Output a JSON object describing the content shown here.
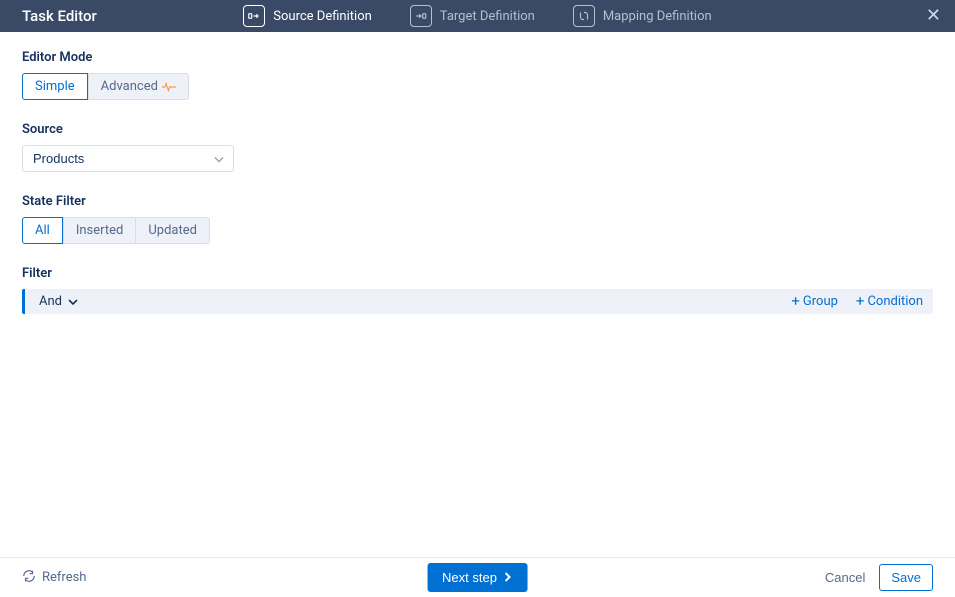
{
  "header": {
    "title": "Task Editor",
    "steps": [
      {
        "label": "Source Definition",
        "active": true
      },
      {
        "label": "Target Definition",
        "active": false
      },
      {
        "label": "Mapping Definition",
        "active": false
      }
    ]
  },
  "editor_mode": {
    "label": "Editor Mode",
    "options": [
      "Simple",
      "Advanced"
    ],
    "active": "Simple"
  },
  "source": {
    "label": "Source",
    "value": "Products"
  },
  "state_filter": {
    "label": "State Filter",
    "options": [
      "All",
      "Inserted",
      "Updated"
    ],
    "active": "All"
  },
  "filter": {
    "label": "Filter",
    "operator": "And",
    "actions": {
      "group": "Group",
      "condition": "Condition"
    }
  },
  "footer": {
    "refresh": "Refresh",
    "next": "Next step",
    "cancel": "Cancel",
    "save": "Save"
  }
}
